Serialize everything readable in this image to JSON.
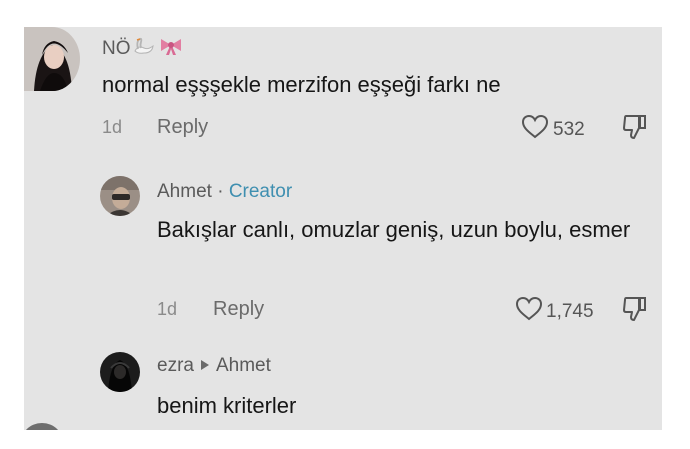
{
  "comments": [
    {
      "username": "NÖ",
      "text": "normal eşşşekle merzifon eşşeği farkı ne",
      "time": "1d",
      "reply_label": "Reply",
      "likes": "532"
    },
    {
      "username": "Ahmet",
      "badge_separator": "·",
      "badge": "Creator",
      "text": "Bakışlar canlı, omuzlar geniş, uzun boylu, esmer",
      "time": "1d",
      "reply_label": "Reply",
      "likes": "1,745"
    },
    {
      "username": "ezra",
      "reply_to": "Ahmet",
      "text": "benim kriterler"
    }
  ],
  "icons": {
    "like": "heart-outline-icon",
    "dislike": "thumbs-down-icon",
    "reply_arrow": "triangle-right-icon",
    "name_emojis": [
      "swan-emoji",
      "bow-emoji"
    ]
  },
  "colors": {
    "background": "#e4e4e4",
    "creator_badge": "#3f8fb0",
    "bow": "#e27ea2"
  }
}
